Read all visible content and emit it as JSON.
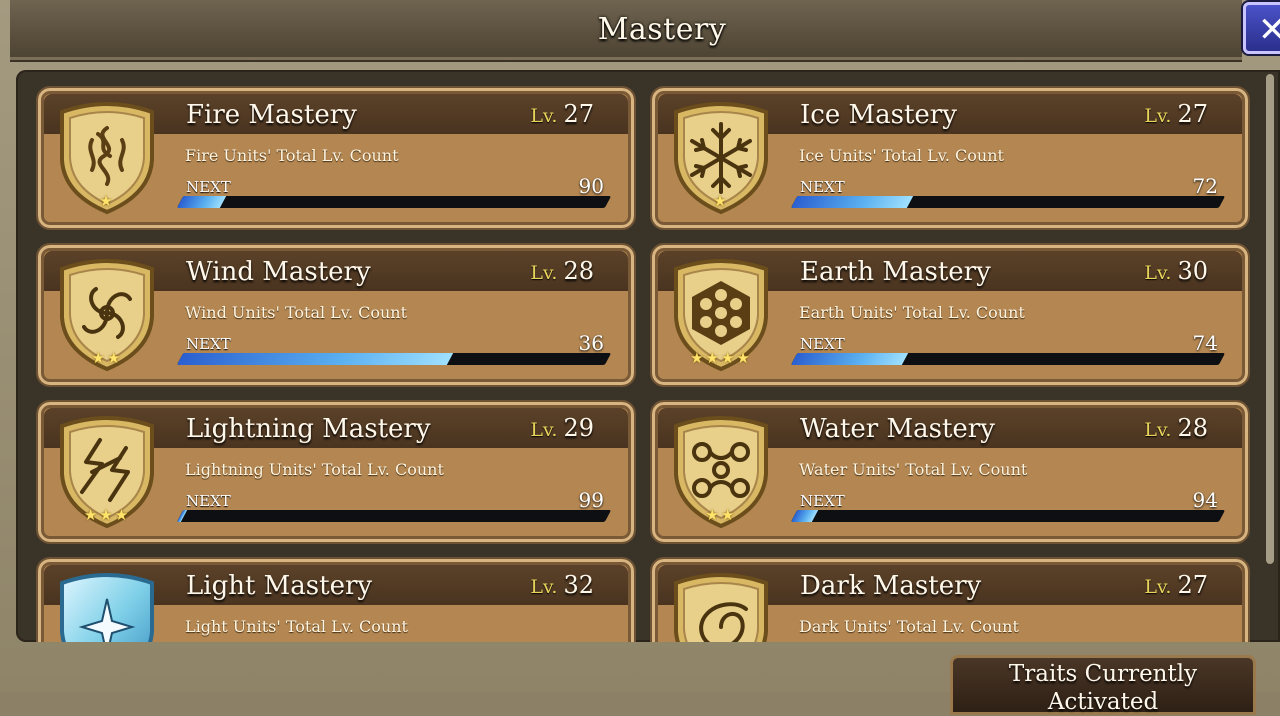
{
  "header": {
    "title": "Mastery",
    "close_label": "✕"
  },
  "cards": [
    {
      "name": "Fire Mastery",
      "lv_label": "Lv.",
      "level": "27",
      "desc": "Fire Units' Total Lv. Count",
      "next_label": "NEXT",
      "next_value": "90",
      "progress": 0.1,
      "stars": "★",
      "icon": "fire-emblem-icon"
    },
    {
      "name": "Ice Mastery",
      "lv_label": "Lv.",
      "level": "27",
      "desc": "Ice Units' Total Lv. Count",
      "next_label": "NEXT",
      "next_value": "72",
      "progress": 0.27,
      "stars": "★",
      "icon": "ice-emblem-icon"
    },
    {
      "name": "Wind Mastery",
      "lv_label": "Lv.",
      "level": "28",
      "desc": "Wind Units' Total Lv. Count",
      "next_label": "NEXT",
      "next_value": "36",
      "progress": 0.63,
      "stars": "★★",
      "icon": "wind-emblem-icon"
    },
    {
      "name": "Earth Mastery",
      "lv_label": "Lv.",
      "level": "30",
      "desc": "Earth Units' Total Lv. Count",
      "next_label": "NEXT",
      "next_value": "74",
      "progress": 0.26,
      "stars": "★★★★",
      "icon": "earth-emblem-icon"
    },
    {
      "name": "Lightning Mastery",
      "lv_label": "Lv.",
      "level": "29",
      "desc": "Lightning Units' Total Lv. Count",
      "next_label": "NEXT",
      "next_value": "99",
      "progress": 0.01,
      "stars": "★★★",
      "icon": "lightning-emblem-icon"
    },
    {
      "name": "Water Mastery",
      "lv_label": "Lv.",
      "level": "28",
      "desc": "Water Units' Total Lv. Count",
      "next_label": "NEXT",
      "next_value": "94",
      "progress": 0.05,
      "stars": "★★",
      "icon": "water-emblem-icon"
    },
    {
      "name": "Light Mastery",
      "lv_label": "Lv.",
      "level": "32",
      "desc": "Light Units' Total Lv. Count",
      "next_label": "",
      "next_value": "",
      "progress": 0,
      "stars": "",
      "icon": "light-emblem-icon"
    },
    {
      "name": "Dark Mastery",
      "lv_label": "Lv.",
      "level": "27",
      "desc": "Dark Units' Total Lv. Count",
      "next_label": "",
      "next_value": "",
      "progress": 0,
      "stars": "",
      "icon": "dark-emblem-icon"
    }
  ],
  "footer": {
    "traits_button": "Traits Currently Activated"
  }
}
